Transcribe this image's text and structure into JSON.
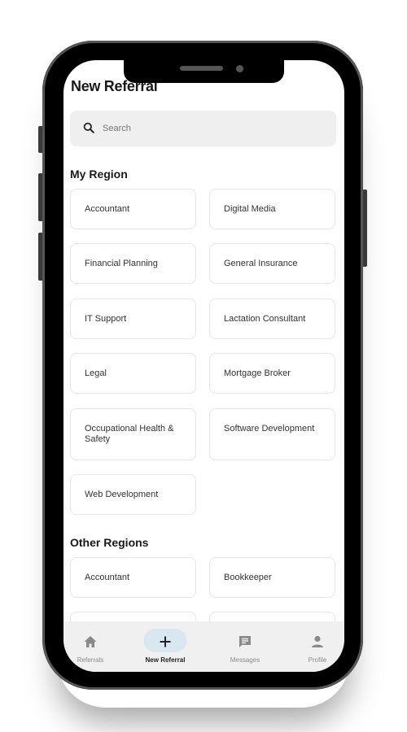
{
  "header": {
    "title": "New Referral"
  },
  "search": {
    "placeholder": "Search"
  },
  "sections": [
    {
      "title": "My Region",
      "items": [
        "Accountant",
        "Digital Media",
        "Financial Planning",
        "General Insurance",
        "IT Support",
        "Lactation Consultant",
        "Legal",
        "Mortgage Broker",
        "Occupational Health & Safety",
        "Software Development",
        "Web Development"
      ]
    },
    {
      "title": "Other Regions",
      "items": [
        "Accountant",
        "Bookkeeper"
      ]
    }
  ],
  "nav": {
    "items": [
      {
        "label": "Referrals",
        "icon": "home-icon",
        "active": false
      },
      {
        "label": "New Referral",
        "icon": "plus-icon",
        "active": true
      },
      {
        "label": "Messages",
        "icon": "message-icon",
        "active": false
      },
      {
        "label": "Profile",
        "icon": "person-icon",
        "active": false
      }
    ]
  },
  "colors": {
    "accent_pill": "#d9e8f0",
    "nav_bg": "#f0f0f0",
    "search_bg": "#efefef"
  }
}
